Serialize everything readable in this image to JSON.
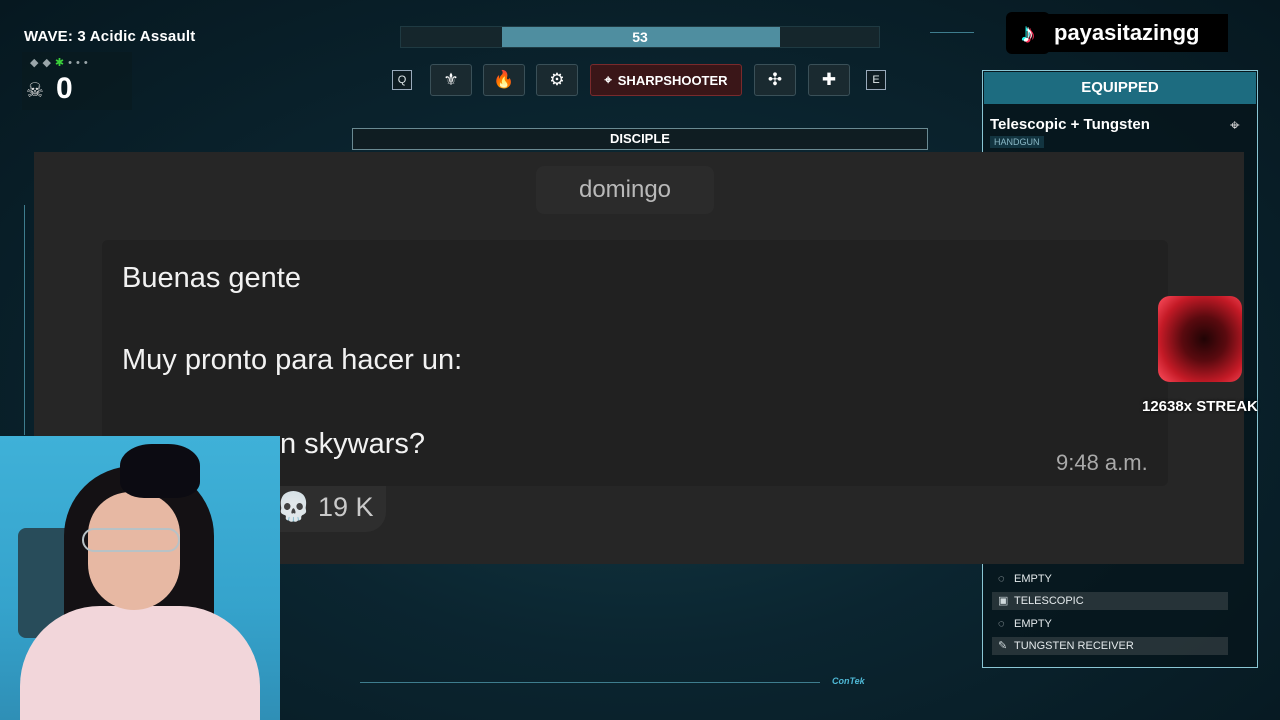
{
  "hud": {
    "wave": "WAVE: 3 Acidic Assault",
    "kills": "0",
    "progress": {
      "value": "53",
      "fill_fraction": 0.58
    },
    "left_key": "Q",
    "right_key": "E",
    "active_ability": "SHARPSHOOTER",
    "class_name": "DISCIPLE",
    "abilities": [
      "rank-icon",
      "fire-icon",
      "gear-icon",
      "crosshair-icon",
      "triangle-blades-icon",
      "medic-cross-icon"
    ]
  },
  "stream": {
    "tiktok_user": "payasitazingg",
    "streak": "12638x STREAK",
    "watermark": "ConTek"
  },
  "equip": {
    "header": "EQUIPPED",
    "weapon_name": "Telescopic + Tungsten",
    "weapon_type": "HANDGUN",
    "attachments": [
      {
        "label": "EMPTY",
        "icon": "scope-slot-icon",
        "highlight": false
      },
      {
        "label": "TELESCOPIC",
        "icon": "sight-icon",
        "highlight": true
      },
      {
        "label": "EMPTY",
        "icon": "muzzle-slot-icon",
        "highlight": false
      },
      {
        "label": "TUNGSTEN RECEIVER",
        "icon": "receiver-icon",
        "highlight": true
      }
    ]
  },
  "chat": {
    "title": "domingo",
    "lines": [
      "Buenas gente",
      "Muy pronto para hacer un:",
      "n skywars?"
    ],
    "time": "9:48 a.m.",
    "reaction_count": "19 K"
  },
  "colors": {
    "equip_header": "#1d6c80",
    "active_ability": "#3a1618",
    "chat_bg": "#262626",
    "webcam_bg": "#3fb1d8"
  }
}
